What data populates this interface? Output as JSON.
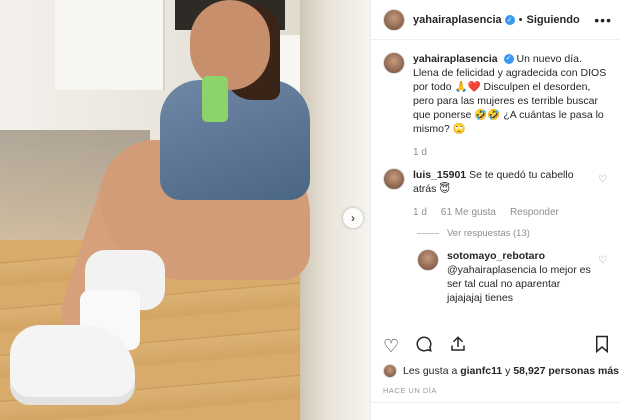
{
  "post": {
    "username": "yahairaplasencia",
    "follow_status": "Siguiendo",
    "caption": "Un nuevo día. Llena de felicidad y agradecida con DIOS por todo 🙏❤️ Disculpen el desorden, pero para las mujeres es terrible buscar que ponerse 🤣🤣 ¿A cuántas le pasa lo mismo? 🙄",
    "caption_time": "1 d"
  },
  "comments": [
    {
      "username": "luis_15901",
      "text": "Se te quedó tu cabello atrás 😇",
      "time": "1 d",
      "likes": "61 Me gusta",
      "reply_label": "Responder",
      "view_replies": "Ver respuestas (13)"
    },
    {
      "username": "sotomayo_rebotaro",
      "text": "@yahairaplasencia lo mejor es ser tal cual no aparentar jajajajaj tienes"
    }
  ],
  "likes_line": {
    "prefix": "Les gusta a",
    "user": "gianfc11",
    "connector": "y",
    "count": "58,927 personas más"
  },
  "timestamp": "HACE UN DÍA",
  "icons": {
    "like": "heart-icon",
    "comment": "comment-icon",
    "share": "share-icon",
    "save": "bookmark-icon"
  },
  "colors": {
    "verified": "#3897f0",
    "text": "#262626",
    "muted": "#8e8e8e"
  }
}
